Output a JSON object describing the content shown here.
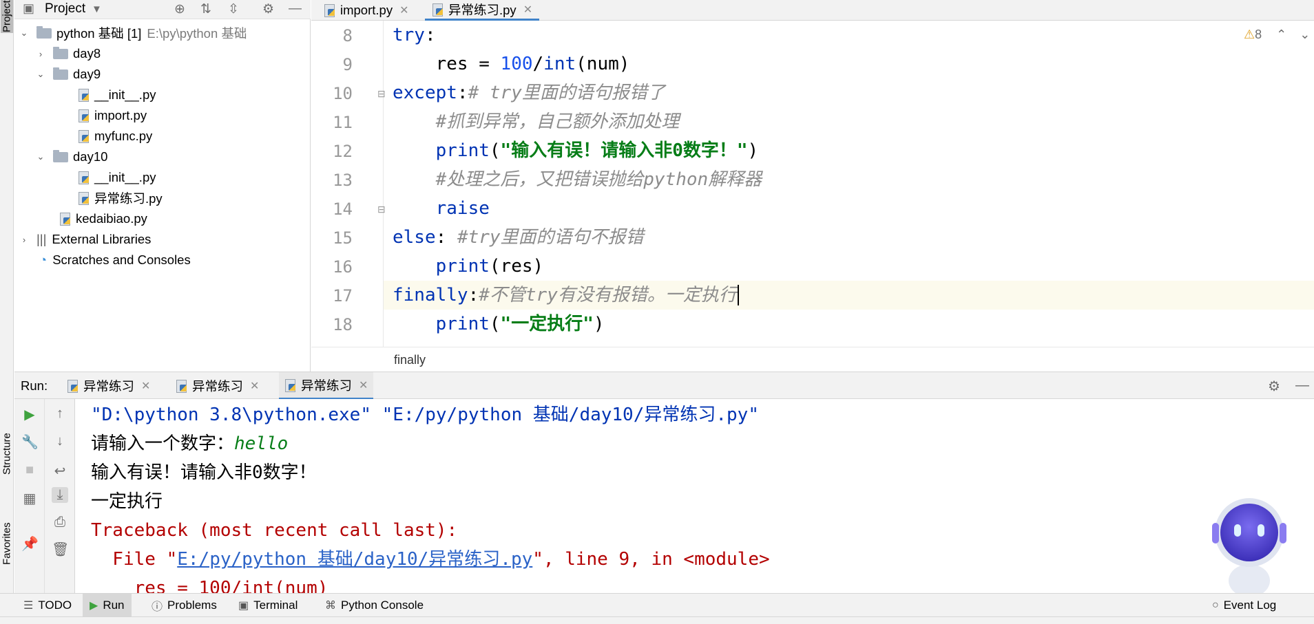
{
  "left_strip": {
    "project_label": "Project",
    "structure_label": "Structure",
    "favorites_label": "Favorites"
  },
  "project": {
    "title": "Project",
    "tree": [
      {
        "label": "python 基础 [1]",
        "path": "E:\\py\\python 基础"
      },
      {
        "label": "day8"
      },
      {
        "label": "day9"
      },
      {
        "label": "__init__.py"
      },
      {
        "label": "import.py"
      },
      {
        "label": "myfunc.py"
      },
      {
        "label": "day10"
      },
      {
        "label": "__init__.py"
      },
      {
        "label": "异常练习.py"
      },
      {
        "label": "kedaibiao.py"
      },
      {
        "label": "External Libraries"
      },
      {
        "label": "Scratches and Consoles"
      }
    ]
  },
  "editor": {
    "tabs": [
      {
        "label": "import.py"
      },
      {
        "label": "异常练习.py"
      }
    ],
    "warnings": "8",
    "line_numbers": [
      "8",
      "9",
      "10",
      "11",
      "12",
      "13",
      "14",
      "15",
      "16",
      "17",
      "18"
    ],
    "code": {
      "l8_kw": "try",
      "l8_p": ":",
      "l9_a": "    res = ",
      "l9_num": "100",
      "l9_b": "/",
      "l9_kw": "int",
      "l9_c": "(num)",
      "l10_kw": "except",
      "l10_p": ":",
      "l10_cm": "# try里面的语句报错了",
      "l11_cm": "    #抓到异常，自己额外添加处理",
      "l12_kw": "    print",
      "l12_a": "(",
      "l12_str": "\"输入有误！请输入非0数字！\"",
      "l12_b": ")",
      "l13_cm": "    #处理之后，又把错误抛给python解释器",
      "l14_kw": "    raise",
      "l15_kw": "else",
      "l15_p": ": ",
      "l15_cm": "#try里面的语句不报错",
      "l16_kw": "    print",
      "l16_a": "(res)",
      "l17_kw": "finally",
      "l17_p": ":",
      "l17_cm": "#不管try有没有报错。一定执行",
      "l18_kw": "    print",
      "l18_a": "(",
      "l18_str": "\"一定执行\"",
      "l18_b": ")"
    },
    "breadcrumb": "finally"
  },
  "run": {
    "label": "Run:",
    "tabs": [
      {
        "label": "异常练习"
      },
      {
        "label": "异常练习"
      },
      {
        "label": "异常练习"
      }
    ],
    "output": {
      "cmd": "\"D:\\python 3.8\\python.exe\" \"E:/py/python 基础/day10/异常练习.py\"",
      "prompt": "请输入一个数字：",
      "input": "hello",
      "err_msg": "输入有误！请输入非0数字！",
      "finally_msg": "一定执行",
      "traceback": "Traceback (most recent call last):",
      "file_pre": "  File \"",
      "file_link": "E:/py/python 基础/day10/异常练习.py",
      "file_post": "\", line 9, in <module>",
      "code_line": "    res = 100/int(num)"
    }
  },
  "bottom_bar": {
    "todo": "TODO",
    "run": "Run",
    "problems": "Problems",
    "terminal": "Terminal",
    "python_console": "Python Console",
    "event_log": "Event Log"
  }
}
